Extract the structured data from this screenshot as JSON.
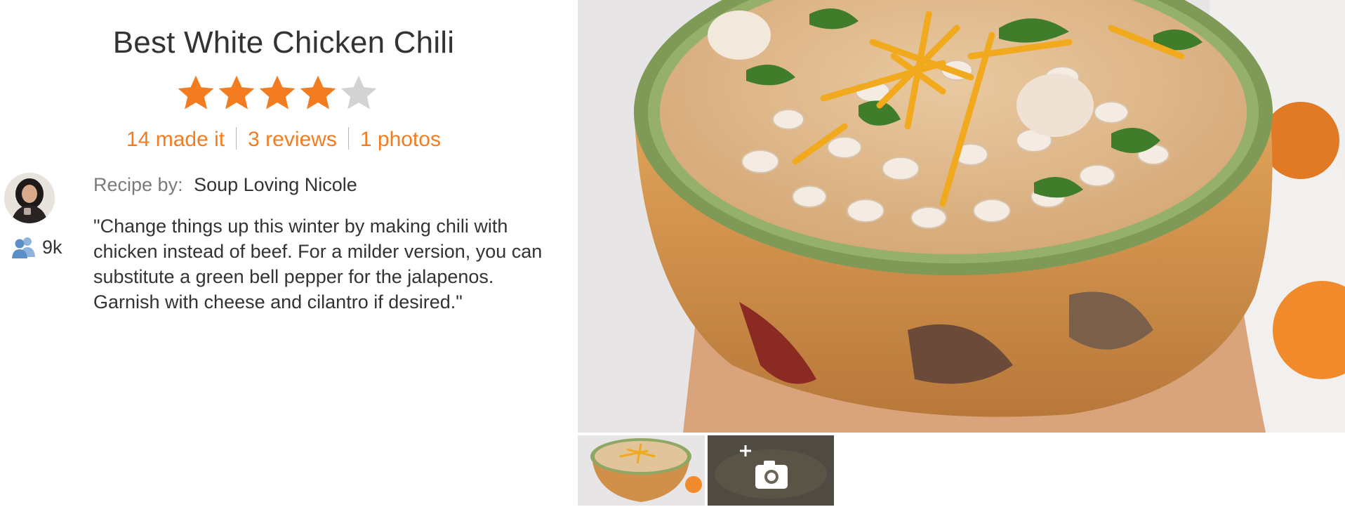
{
  "recipe": {
    "title": "Best White Chicken Chili",
    "rating": {
      "value": 4,
      "max": 5
    },
    "stats": {
      "made_it": "14 made it",
      "reviews": "3 reviews",
      "photos": "1 photos"
    },
    "author": {
      "label": "Recipe by:",
      "name": "Soup Loving Nicole",
      "followers": "9k"
    },
    "description": "\"Change things up this winter by making chili with chicken instead of beef. For a milder version, you can substitute a green bell pepper for the jalapenos. Garnish with cheese and cilantro if desired.\""
  },
  "colors": {
    "accent": "#f47c20",
    "star_filled": "#f47c20",
    "star_empty": "#d3d3d3",
    "follower_icon": "#5b8fc7"
  },
  "icons": {
    "followers": "people-icon",
    "add_photo": "camera-plus-icon"
  }
}
